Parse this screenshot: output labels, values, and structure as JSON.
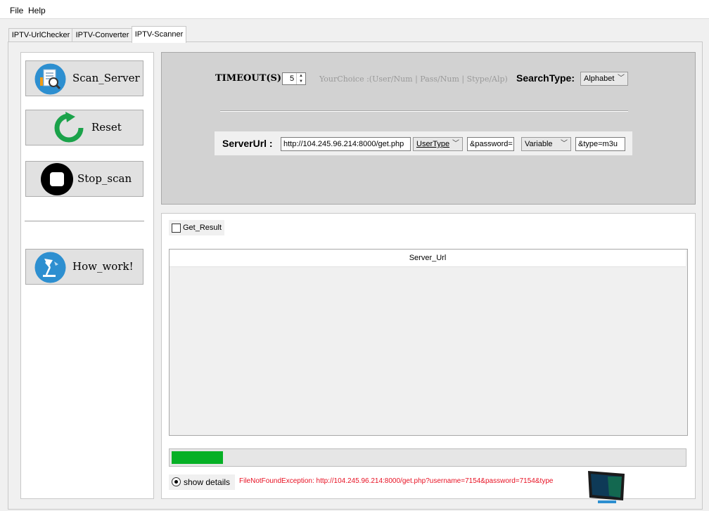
{
  "menu": {
    "file": "File",
    "help": "Help"
  },
  "tabs": [
    "IPTV-UrlChecker",
    "IPTV-Converter",
    "IPTV-Scanner"
  ],
  "left_buttons": {
    "scan": "Scan_Server",
    "reset": "Reset",
    "stop": "Stop_scan",
    "how": "How_work!"
  },
  "settings": {
    "timeout_label": "TIMEOUT(S):",
    "timeout_value": "5",
    "your_choice": "YourChoice :(User/Num | Pass/Num | Stype/Alp)",
    "search_type_label": "SearchType:",
    "search_type_value": "Alphabet"
  },
  "server_url": {
    "label": "ServerUrl :",
    "url": "http://104.245.96.214:8000/get.php",
    "user_type": "UserType",
    "password_param": "&password=",
    "variable": "Variable",
    "type_param": "&type=m3u"
  },
  "results": {
    "get_result_label": "Get_Result",
    "column_header": "Server_Url"
  },
  "progress": {
    "value_percent": 10
  },
  "status": {
    "show_details": "show details",
    "error": "FileNotFoundException: http://104.245.96.214:8000/get.php?username=7154&password=7154&type"
  },
  "colors": {
    "accent_blue": "#2d8fd0",
    "reset_green": "#1aa24a",
    "progress_green": "#06b025",
    "error_red": "#e81123"
  }
}
